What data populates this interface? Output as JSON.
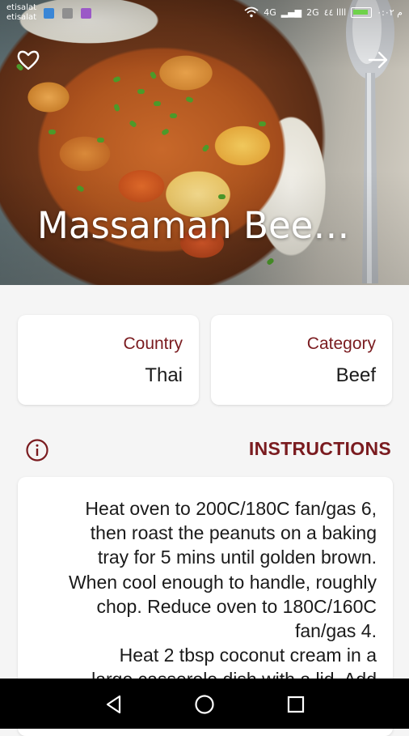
{
  "status_bar": {
    "carrier_line1": "etisalat",
    "carrier_line2": "etisalat",
    "network_1": "4G",
    "network_2": "2G",
    "signal_text": "اااا ٤٤",
    "time": "م ٠:٠٢"
  },
  "hero": {
    "title": "Massaman Bee…",
    "favorite_icon": "heart-outline-icon",
    "share_icon": "arrow-right-icon"
  },
  "info_cards": [
    {
      "label": "Country",
      "value": "Thai"
    },
    {
      "label": "Category",
      "value": "Beef"
    }
  ],
  "instructions": {
    "icon": "info-circle-icon",
    "title": "INSTRUCTIONS",
    "text": "Heat oven to 200C/180C fan/gas 6,\nthen roast the peanuts on a baking\ntray for 5 mins until golden brown.\nWhen cool enough to handle, roughly\nchop. Reduce oven to 180C/160C\nfan/gas 4.\nHeat 2 tbsp coconut cream in a\nlarge casserole dish with a lid. Add"
  },
  "colors": {
    "accent": "#7a1b1f",
    "background": "#f5f5f5",
    "card": "#ffffff",
    "nav_bar": "#000000"
  },
  "nav_bar": {
    "back_icon": "triangle-back-icon",
    "home_icon": "circle-home-icon",
    "recents_icon": "square-recents-icon"
  }
}
